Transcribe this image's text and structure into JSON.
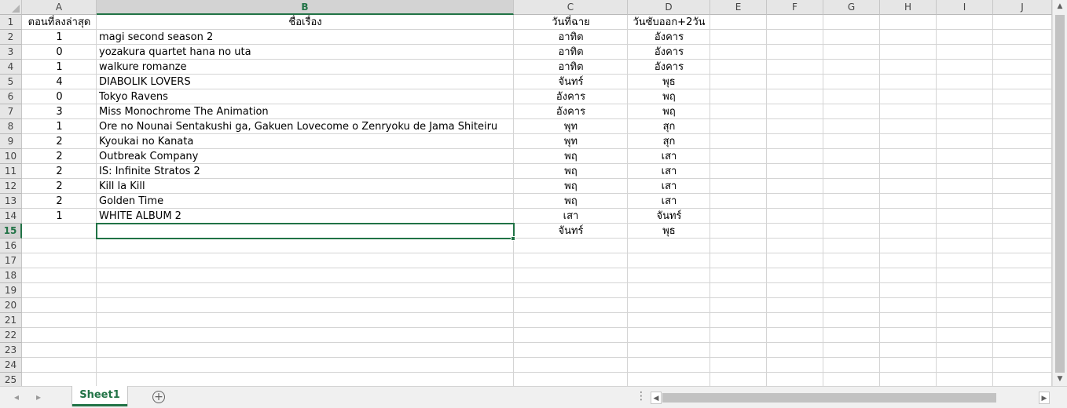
{
  "columns": [
    "A",
    "B",
    "C",
    "D",
    "E",
    "F",
    "G",
    "H",
    "I",
    "J"
  ],
  "selected_column": "B",
  "rows": [
    "1",
    "2",
    "3",
    "4",
    "5",
    "6",
    "7",
    "8",
    "9",
    "10",
    "11",
    "12",
    "13",
    "14",
    "15",
    "16",
    "17",
    "18",
    "19",
    "20",
    "21",
    "22",
    "23",
    "24",
    "25"
  ],
  "selected_row": "15",
  "header_row": {
    "a": "ตอนที่ลงล่าสุด",
    "b": "ชื่อเรื่อง",
    "c": "วันที่ฉาย",
    "d": "วันซับออก+2วัน"
  },
  "data_rows": [
    {
      "a": "1",
      "b": "magi second season 2",
      "c": "อาทิต",
      "d": "อังคาร"
    },
    {
      "a": "0",
      "b": "yozakura quartet hana no uta",
      "c": "อาทิต",
      "d": "อังคาร"
    },
    {
      "a": "1",
      "b": "walkure romanze",
      "c": "อาทิต",
      "d": "อังคาร"
    },
    {
      "a": "4",
      "b": "DIABOLIK LOVERS",
      "c": "จันทร์",
      "d": "พุธ"
    },
    {
      "a": "0",
      "b": "Tokyo Ravens",
      "c": "อังคาร",
      "d": "พฤ"
    },
    {
      "a": "3",
      "b": "Miss Monochrome The Animation",
      "c": "อังคาร",
      "d": "พฤ"
    },
    {
      "a": "1",
      "b": "Ore no Nounai Sentakushi ga, Gakuen Lovecome o Zenryoku de Jama Shiteiru",
      "c": "พุท",
      "d": "สุก"
    },
    {
      "a": "2",
      "b": "Kyoukai no Kanata",
      "c": "พุท",
      "d": "สุก"
    },
    {
      "a": "2",
      "b": "Outbreak Company",
      "c": "พฤ",
      "d": "เสา"
    },
    {
      "a": "2",
      "b": "IS: Infinite Stratos 2",
      "c": "พฤ",
      "d": "เสา"
    },
    {
      "a": "2",
      "b": "Kill la Kill",
      "c": "พฤ",
      "d": "เสา"
    },
    {
      "a": "2",
      "b": "Golden Time",
      "c": "พฤ",
      "d": "เสา"
    },
    {
      "a": "1",
      "b": "WHITE ALBUM 2",
      "c": "เสา",
      "d": "จันทร์"
    },
    {
      "a": "",
      "b": "",
      "c": "จันทร์",
      "d": "พุธ"
    }
  ],
  "sheet_tab": "Sheet1",
  "icons": {
    "add_sheet": "plus-circle-icon",
    "prev_sheet": "chevron-left-icon",
    "next_sheet": "chevron-right-icon",
    "split": "vertical-ellipsis-icon"
  },
  "colors": {
    "accent": "#217346",
    "header_bg": "#e6e6e6",
    "grid_line": "#d4d4d4"
  }
}
